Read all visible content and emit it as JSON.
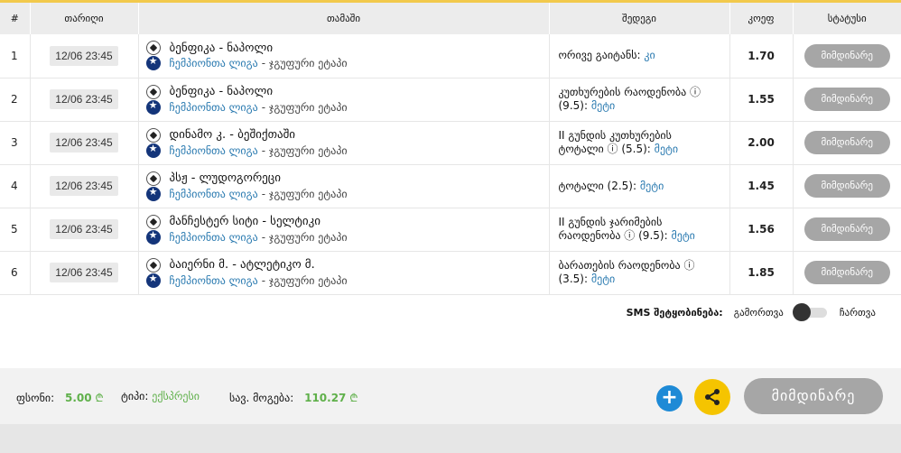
{
  "headers": {
    "num": "#",
    "date": "თარიღი",
    "game": "თამაში",
    "market": "შედეგი",
    "odds": "კოეფ",
    "status": "სტატუსი"
  },
  "rows": [
    {
      "num": "1",
      "date": "12/06 23:45",
      "match": "ბენფიკა - ნაპოლი",
      "league": "ჩემპიონთა ლიგა",
      "stage": "- ჯგუფური ეტაპი",
      "market": "ორივე გაიტანს:",
      "market2": "",
      "pick": "კი",
      "odds": "1.70",
      "status": "მიმდინარე"
    },
    {
      "num": "2",
      "date": "12/06 23:45",
      "match": "ბენფიკა - ნაპოლი",
      "league": "ჩემპიონთა ლიგა",
      "stage": "- ჯგუფური ეტაპი",
      "market": "კუთხურების რაოდენობა ⓘ",
      "market2": "(9.5):",
      "pick": "მეტი",
      "odds": "1.55",
      "status": "მიმდინარე"
    },
    {
      "num": "3",
      "date": "12/06 23:45",
      "match": "დინამო კ. - ბეშიქთაში",
      "league": "ჩემპიონთა ლიგა",
      "stage": "- ჯგუფური ეტაპი",
      "market": "II გუნდის კუთხურების",
      "market2": "ტოტალი ⓘ (5.5):",
      "pick": "მეტი",
      "odds": "2.00",
      "status": "მიმდინარე"
    },
    {
      "num": "4",
      "date": "12/06 23:45",
      "match": "პსჟ - ლუდოგორეცი",
      "league": "ჩემპიონთა ლიგა",
      "stage": "- ჯგუფური ეტაპი",
      "market": "ტოტალი (2.5):",
      "market2": "",
      "pick": "მეტი",
      "odds": "1.45",
      "status": "მიმდინარე"
    },
    {
      "num": "5",
      "date": "12/06 23:45",
      "match": "მანჩესტერ სიტი - სელტიკი",
      "league": "ჩემპიონთა ლიგა",
      "stage": "- ჯგუფური ეტაპი",
      "market": "II გუნდის ჯარიმების",
      "market2": "რაოდენობა ⓘ (9.5):",
      "pick": "მეტი",
      "odds": "1.56",
      "status": "მიმდინარე"
    },
    {
      "num": "6",
      "date": "12/06 23:45",
      "match": "ბაიერნი მ. - ატლეტიკო მ.",
      "league": "ჩემპიონთა ლიგა",
      "stage": "- ჯგუფური ეტაპი",
      "market": "ბარათების რაოდენობა ⓘ",
      "market2": "(3.5):",
      "pick": "მეტი",
      "odds": "1.85",
      "status": "მიმდინარე"
    }
  ],
  "sms": {
    "label": "SMS შეტყობინება:",
    "off": "გამორთვა",
    "on": "ჩართვა"
  },
  "footer": {
    "stake_label": "ფსონი:",
    "stake_value": "5.00",
    "currency": "₾",
    "type_label": "ტიპი:",
    "type_value": "ექსპრესი",
    "win_label": "სავ. მოგება:",
    "win_value": "110.27",
    "plus": "+",
    "status_button": "მიმდინარე"
  },
  "colors": {
    "accent_yellow": "#f5c400",
    "blue": "#1e8ad6",
    "green": "#5fb04a",
    "gray_button": "#a6a6a6",
    "link": "#2a7ab0"
  },
  "icons": [
    "soccer-ball-icon",
    "champions-league-icon",
    "toggle-switch",
    "plus-icon",
    "share-icon"
  ]
}
